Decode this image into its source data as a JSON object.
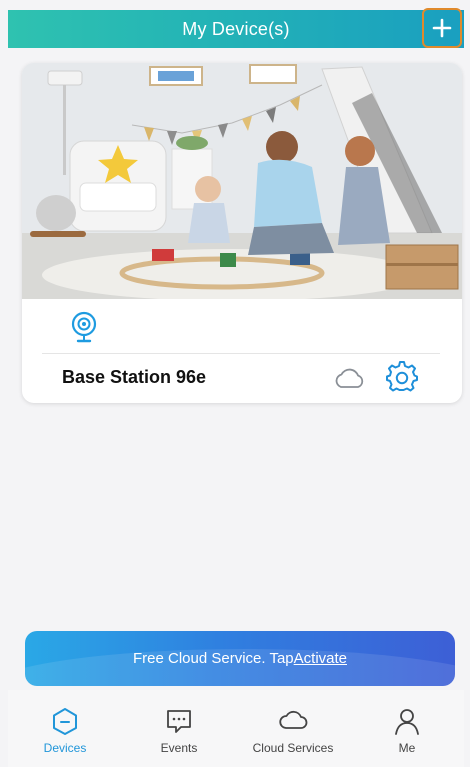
{
  "header": {
    "title": "My Device(s)"
  },
  "device": {
    "name": "Base Station 96e"
  },
  "banner": {
    "text": "Free Cloud Service. Tap",
    "link": "Activate"
  },
  "tabs": [
    {
      "label": "Devices",
      "icon": "devices-icon",
      "active": true
    },
    {
      "label": "Events",
      "icon": "events-icon",
      "active": false
    },
    {
      "label": "Cloud Services",
      "icon": "cloud-services-icon",
      "active": false
    },
    {
      "label": "Me",
      "icon": "person-icon",
      "active": false
    }
  ],
  "colors": {
    "header_start": "#2fc2b0",
    "header_end": "#1a9fc0",
    "accent_blue": "#2196d9",
    "highlight_orange": "#e08a2c"
  }
}
